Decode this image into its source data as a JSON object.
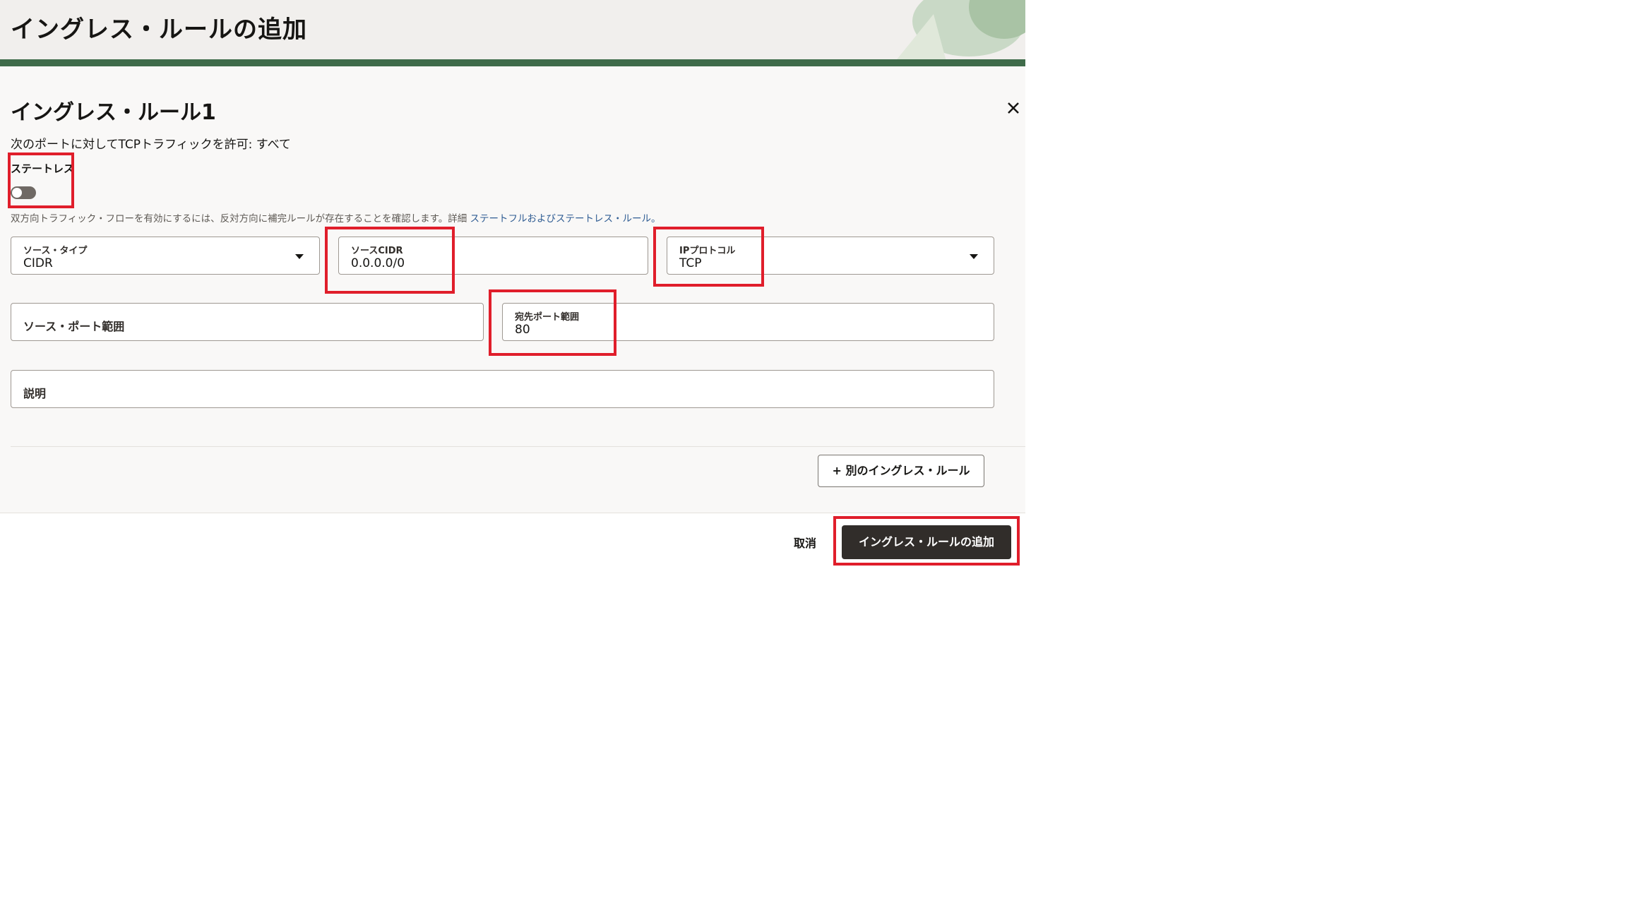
{
  "header": {
    "title": "イングレス・ルールの追加"
  },
  "rule": {
    "title": "イングレス・ルール1",
    "allow_text": "次のポートに対してTCPトラフィックを許可: すべて",
    "stateless_label": "ステートレス",
    "stateless_on": false,
    "help_text": "双方向トラフィック・フローを有効にするには、反対方向に補完ルールが存在することを確認します。詳細",
    "help_link": "ステートフルおよびステートレス・ルール。"
  },
  "fields": {
    "source_type": {
      "label": "ソース・タイプ",
      "value": "CIDR"
    },
    "source_cidr": {
      "label": "ソースCIDR",
      "value": "0.0.0.0/0"
    },
    "ip_protocol": {
      "label": "IPプロトコル",
      "value": "TCP"
    },
    "source_port": {
      "label": "ソース・ポート範囲"
    },
    "dest_port": {
      "label": "宛先ポート範囲",
      "value": "80"
    },
    "description": {
      "label": "説明"
    }
  },
  "buttons": {
    "add_another": "+ 別のイングレス・ルール",
    "cancel": "取消",
    "submit": "イングレス・ルールの追加"
  },
  "icons": {
    "close": "close-icon",
    "dropdown": "chevron-down-icon"
  },
  "colors": {
    "highlight": "#e01e2b",
    "primary_button": "#312d2a",
    "link": "#2f5c93"
  }
}
